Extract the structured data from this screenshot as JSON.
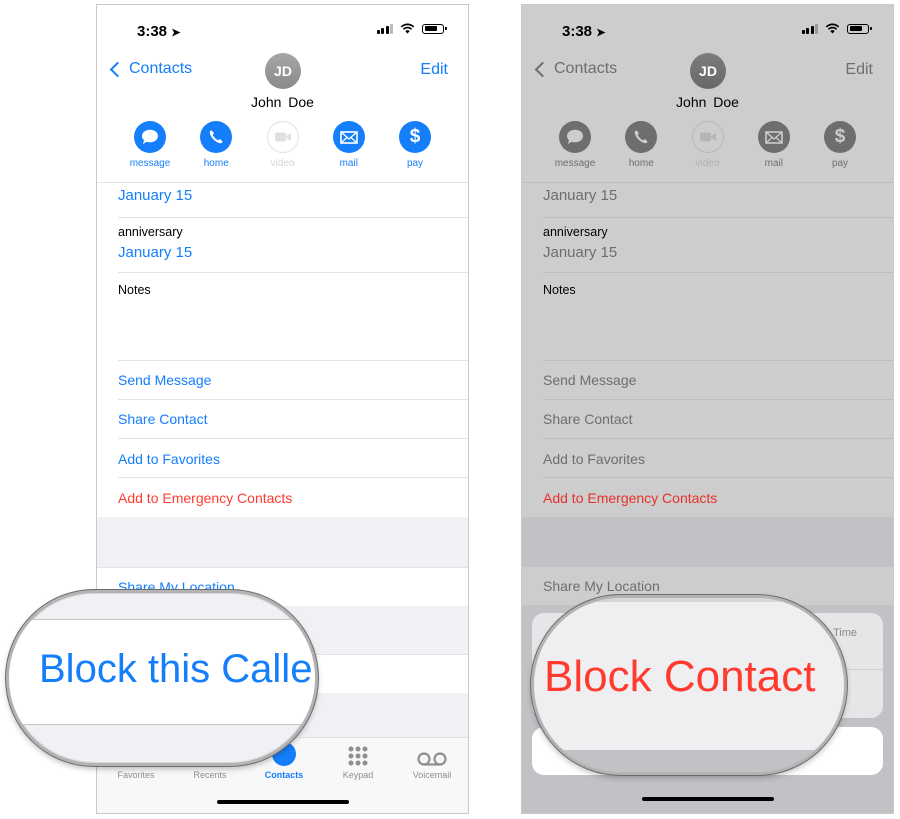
{
  "colors": {
    "ios_blue": "#147efb",
    "ios_red": "#ff3b30",
    "dimmed_gray": "#6e6e6e",
    "tab_gray": "#8e8e93"
  },
  "status_bar": {
    "time": "3:38"
  },
  "nav": {
    "back_label": "Contacts",
    "edit_label": "Edit"
  },
  "contact": {
    "initials": "JD",
    "name": "John  Doe"
  },
  "actions": [
    {
      "label": "message",
      "icon": "message-bubble-icon",
      "enabled": true
    },
    {
      "label": "home",
      "icon": "phone-icon",
      "enabled": true
    },
    {
      "label": "video",
      "icon": "video-camera-icon",
      "enabled": false
    },
    {
      "label": "mail",
      "icon": "envelope-icon",
      "enabled": true
    },
    {
      "label": "pay",
      "icon": "dollar-icon",
      "enabled": true
    }
  ],
  "details": {
    "birthday_value": "January 15",
    "anniversary_label": "anniversary",
    "anniversary_value": "January 15",
    "notes_label": "Notes"
  },
  "menu_items": {
    "send_message": "Send Message",
    "share_contact": "Share Contact",
    "add_favorites": "Add to Favorites",
    "add_emergency": "Add to Emergency Contacts",
    "share_location": "Share My Location",
    "block_caller": "Block this Caller",
    "block_caller_visible": "Block this Calle"
  },
  "tabbar": [
    {
      "label": "Favorites",
      "active": false
    },
    {
      "label": "Recents",
      "active": false
    },
    {
      "label": "Contacts",
      "active": true
    },
    {
      "label": "Keypad",
      "active": false
    },
    {
      "label": "Voicemail",
      "active": false
    }
  ],
  "action_sheet": {
    "partial_text": "Time",
    "block_contact": "Block Contact"
  }
}
